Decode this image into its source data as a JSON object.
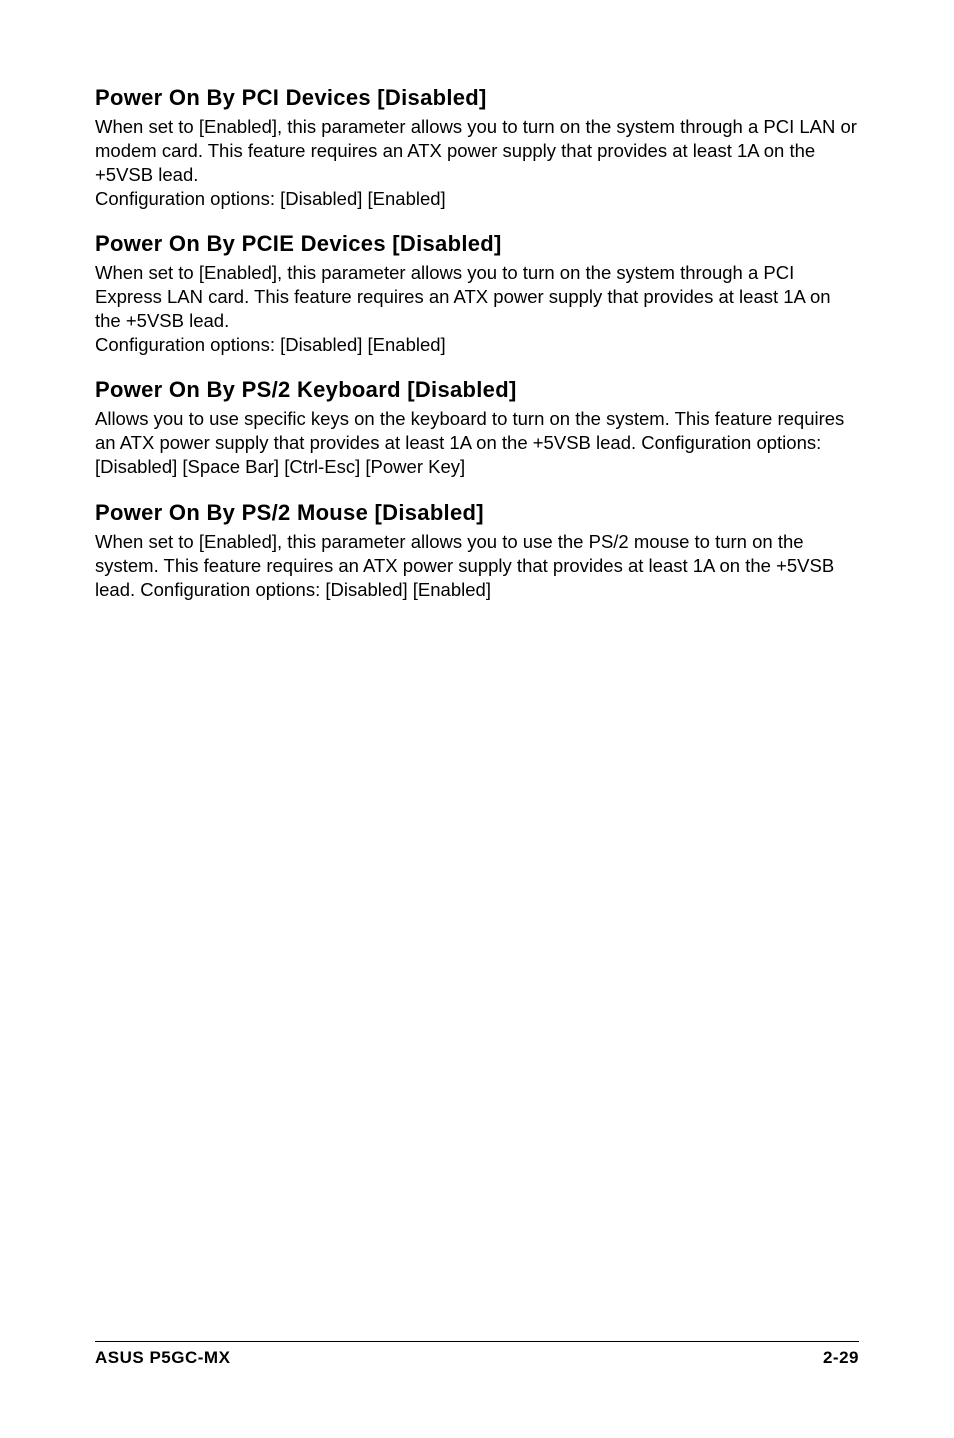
{
  "sections": [
    {
      "title": "Power On By PCI Devices [Disabled]",
      "body": "When set to [Enabled], this parameter allows you to turn on the system through a PCI LAN or modem card. This feature requires an ATX power supply that provides at least 1A on the +5VSB lead.\nConfiguration options: [Disabled] [Enabled]"
    },
    {
      "title": "Power On By PCIE Devices [Disabled]",
      "body": "When set to [Enabled], this parameter allows you to turn on the system through a PCI Express LAN card. This feature requires an ATX power supply that provides at least 1A on the +5VSB lead.\nConfiguration options: [Disabled] [Enabled]"
    },
    {
      "title": "Power On By PS/2 Keyboard [Disabled]",
      "body": "Allows you to use specific keys on the keyboard to turn on the system. This feature requires an ATX power supply that provides at least 1A on the +5VSB lead. Configuration options: [Disabled] [Space Bar] [Ctrl-Esc] [Power Key]"
    },
    {
      "title": "Power On By PS/2 Mouse [Disabled]",
      "body": "When set to [Enabled], this parameter allows you to use the PS/2 mouse to turn on the system. This feature requires an ATX power supply that provides at least 1A on the +5VSB lead. Configuration options: [Disabled] [Enabled]"
    }
  ],
  "footer": {
    "left": "ASUS P5GC-MX",
    "right": "2-29"
  }
}
